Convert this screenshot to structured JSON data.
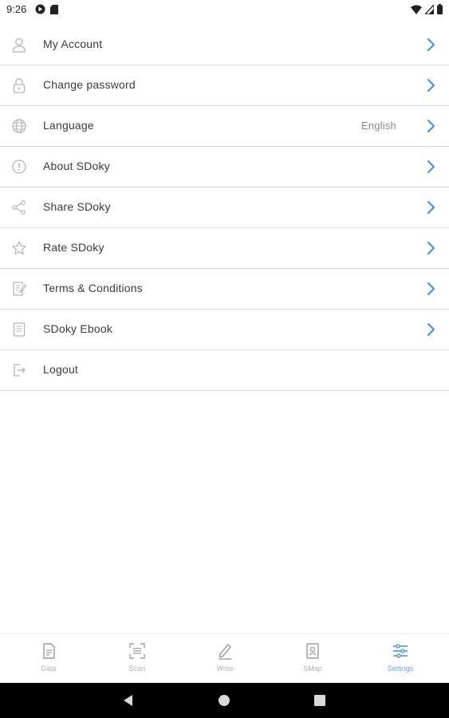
{
  "status_bar": {
    "time": "9:26",
    "left_icons": [
      "google-play-icon",
      "sd-card-icon"
    ],
    "right_icons": [
      "wifi-icon",
      "signal-icon",
      "battery-icon"
    ]
  },
  "settings": {
    "items": [
      {
        "label": "My Account",
        "icon": "user-icon",
        "chevron": true
      },
      {
        "label": "Change password",
        "icon": "lock-icon",
        "chevron": true
      },
      {
        "label": "Language",
        "icon": "globe-icon",
        "value": "English",
        "chevron": true
      },
      {
        "label": "About SDoky",
        "icon": "info-icon",
        "chevron": true
      },
      {
        "label": "Share SDoky",
        "icon": "share-icon",
        "chevron": true
      },
      {
        "label": "Rate SDoky",
        "icon": "star-icon",
        "chevron": true
      },
      {
        "label": "Terms & Conditions",
        "icon": "terms-icon",
        "chevron": true
      },
      {
        "label": "SDoky Ebook",
        "icon": "ebook-icon",
        "chevron": true
      },
      {
        "label": "Logout",
        "icon": "logout-icon",
        "chevron": false
      }
    ]
  },
  "bottom_nav": {
    "items": [
      {
        "label": "Data",
        "icon": "data-icon",
        "active": false
      },
      {
        "label": "Scan",
        "icon": "scan-icon",
        "active": false
      },
      {
        "label": "Write",
        "icon": "write-icon",
        "active": false
      },
      {
        "label": "SMap",
        "icon": "smap-icon",
        "active": false
      },
      {
        "label": "Settings",
        "icon": "settings-icon",
        "active": true
      }
    ]
  },
  "colors": {
    "accent": "#3b8fe0",
    "icon_gray": "#b3b3b3",
    "divider": "#d9d9d9",
    "nav_inactive": "#b0b0b0",
    "nav_active": "#6aa6e0"
  }
}
